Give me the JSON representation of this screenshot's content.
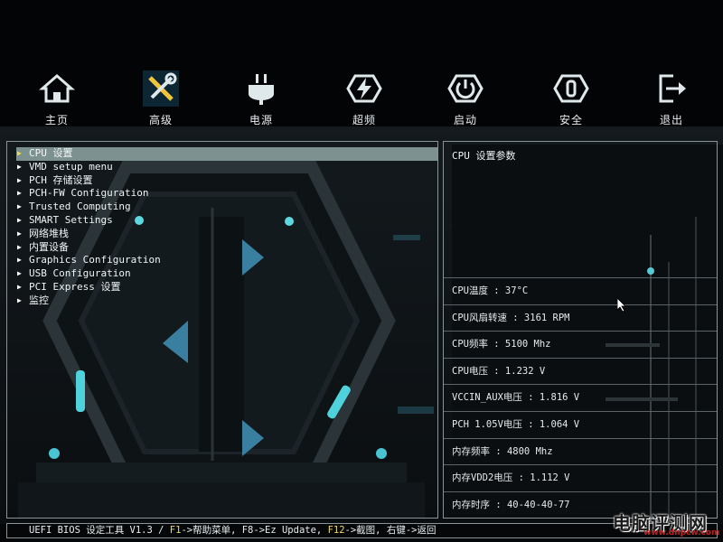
{
  "nav": [
    {
      "label": "主页",
      "icon": "home-icon"
    },
    {
      "label": "高级",
      "icon": "tools-icon"
    },
    {
      "label": "电源",
      "icon": "power-plug-icon"
    },
    {
      "label": "超频",
      "icon": "overclock-bolt-icon"
    },
    {
      "label": "启动",
      "icon": "boot-power-icon"
    },
    {
      "label": "安全",
      "icon": "security-icon"
    },
    {
      "label": "退出",
      "icon": "exit-icon"
    }
  ],
  "menu": [
    {
      "label": "CPU 设置"
    },
    {
      "label": "VMD setup menu"
    },
    {
      "label": "PCH 存储设置"
    },
    {
      "label": "PCH-FW Configuration"
    },
    {
      "label": "Trusted Computing"
    },
    {
      "label": "SMART Settings"
    },
    {
      "label": "网络堆栈"
    },
    {
      "label": "内置设备"
    },
    {
      "label": "Graphics Configuration"
    },
    {
      "label": "USB Configuration"
    },
    {
      "label": "PCI Express 设置"
    },
    {
      "label": "监控"
    }
  ],
  "help": {
    "title": "CPU 设置参数"
  },
  "hardware": [
    "CPU温度 : 37°C",
    "CPU风扇转速 : 3161 RPM",
    "CPU频率 : 5100 Mhz",
    "CPU电压 : 1.232 V",
    "VCCIN_AUX电压 : 1.816 V",
    "PCH 1.05V电压 : 1.064 V",
    "内存频率 : 4800 Mhz",
    "内存VDD2电压 : 1.112 V",
    "内存时序 : 40-40-40-77"
  ],
  "footer": {
    "prefix": "UEFI BIOS 设定工具 V1.3 / ",
    "key_f1": "F1",
    "f1_text": "->帮助菜单, F8->Ez Update, ",
    "key_f12": "F12",
    "f12_text": "->截图, 右键->返回"
  },
  "watermark": {
    "text": "电脑评测网",
    "url": "www.dnpcw.com"
  },
  "colors": {
    "accent": "#3fb8c8",
    "selected_row": "#7d9190",
    "key_highlight": "#f0d860"
  }
}
